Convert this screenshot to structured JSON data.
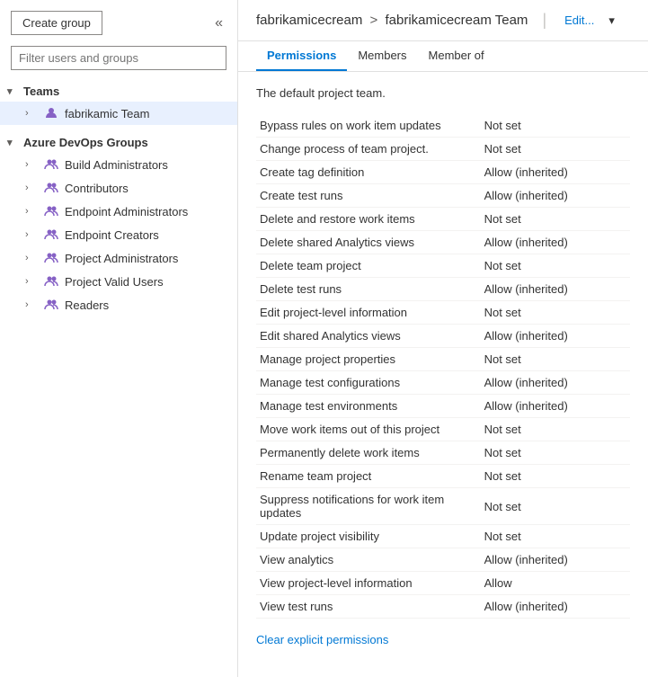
{
  "sidebar": {
    "create_group_label": "Create group",
    "collapse_icon": "«",
    "filter_placeholder": "Filter users and groups",
    "teams_label": "Teams",
    "teams_items": [
      {
        "name": "fabrikamic Team",
        "selected": true
      }
    ],
    "azure_devops_label": "Azure DevOps Groups",
    "azure_devops_items": [
      {
        "name": "Build Administrators"
      },
      {
        "name": "Contributors"
      },
      {
        "name": "Endpoint Administrators"
      },
      {
        "name": "Endpoint Creators"
      },
      {
        "name": "Project Administrators"
      },
      {
        "name": "Project Valid Users"
      },
      {
        "name": "Readers"
      }
    ]
  },
  "main": {
    "breadcrumb_org": "fabrikamicecream",
    "breadcrumb_sep": ">",
    "breadcrumb_team": "fabrikamicecream Team",
    "header_divider": "|",
    "edit_label": "Edit...",
    "dropdown_icon": "▾",
    "tabs": [
      {
        "label": "Permissions",
        "active": true
      },
      {
        "label": "Members",
        "active": false
      },
      {
        "label": "Member of",
        "active": false
      }
    ],
    "default_team_desc": "The default project team.",
    "permissions": [
      {
        "name": "Bypass rules on work item updates",
        "status": "Not set"
      },
      {
        "name": "Change process of team project.",
        "status": "Not set"
      },
      {
        "name": "Create tag definition",
        "status": "Allow (inherited)"
      },
      {
        "name": "Create test runs",
        "status": "Allow (inherited)"
      },
      {
        "name": "Delete and restore work items",
        "status": "Not set"
      },
      {
        "name": "Delete shared Analytics views",
        "status": "Allow (inherited)"
      },
      {
        "name": "Delete team project",
        "status": "Not set"
      },
      {
        "name": "Delete test runs",
        "status": "Allow (inherited)"
      },
      {
        "name": "Edit project-level information",
        "status": "Not set"
      },
      {
        "name": "Edit shared Analytics views",
        "status": "Allow (inherited)"
      },
      {
        "name": "Manage project properties",
        "status": "Not set"
      },
      {
        "name": "Manage test configurations",
        "status": "Allow (inherited)"
      },
      {
        "name": "Manage test environments",
        "status": "Allow (inherited)"
      },
      {
        "name": "Move work items out of this project",
        "status": "Not set"
      },
      {
        "name": "Permanently delete work items",
        "status": "Not set"
      },
      {
        "name": "Rename team project",
        "status": "Not set"
      },
      {
        "name": "Suppress notifications for work item updates",
        "status": "Not set"
      },
      {
        "name": "Update project visibility",
        "status": "Not set"
      },
      {
        "name": "View analytics",
        "status": "Allow (inherited)"
      },
      {
        "name": "View project-level information",
        "status": "Allow"
      },
      {
        "name": "View test runs",
        "status": "Allow (inherited)"
      }
    ],
    "clear_permissions_label": "Clear explicit permissions"
  }
}
